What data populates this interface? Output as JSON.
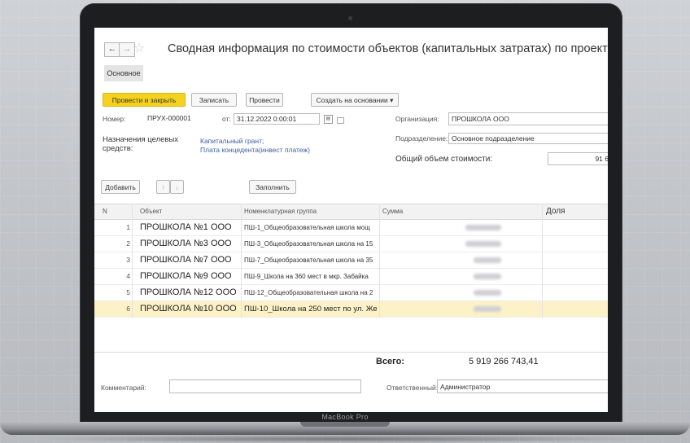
{
  "device_label": "MacBook Pro",
  "window": {
    "title": "Сводная информация по стоимости объектов (капитальных затратах) по проектам груп",
    "nav": {
      "back": "←",
      "forward": "→",
      "favorite": "☆"
    }
  },
  "tabs": {
    "main": "Основное"
  },
  "toolbar": {
    "post_close": "Провести и закрыть",
    "save": "Записать",
    "post": "Провести",
    "create_based": "Создать на основании ▾"
  },
  "form": {
    "number_label": "Номер:",
    "number_value": "ПРУХ-000001",
    "date_label": "от:",
    "date_value": "31.12.2022  0:00:01",
    "purpose_label_1": "Назначения целевых",
    "purpose_label_2": "средств:",
    "purpose_link_1": "Капитальный грант;",
    "purpose_link_2": "Плата концедента(инвест платеж)",
    "org_label": "Организация:",
    "org_value": "ПРОШКОЛА   ООО",
    "division_label": "Подразделение:",
    "division_value": "Основное подразделение",
    "total_cost_label": "Общий объем стоимости:",
    "total_cost_value": "91 6"
  },
  "table_toolbar": {
    "add": "Добавить",
    "up": "↑",
    "down": "↓",
    "fill": "Заполнить"
  },
  "table": {
    "headers": [
      "N",
      "Объект",
      "Номенклатурная группа",
      "Сумма",
      "Доля"
    ],
    "rows": [
      {
        "n": "1",
        "object": "ПРОШКОЛА №1 ООО",
        "group": "ПШ-1_Общеобразовательная школа мощ"
      },
      {
        "n": "2",
        "object": "ПРОШКОЛА №3 ООО",
        "group": "ПШ-3_Общеобразовательная школа на 15"
      },
      {
        "n": "3",
        "object": "ПРОШКОЛА №7 ООО",
        "group": "ПШ-7_Общеобразовательная школа на 35"
      },
      {
        "n": "4",
        "object": "ПРОШКОЛА №9 ООО",
        "group": "ПШ-9_Школа на 360 мест в мкр. Забайка"
      },
      {
        "n": "5",
        "object": "ПРОШКОЛА №12 ООО",
        "group": "ПШ-12_Общеобразовательная школа на 2"
      },
      {
        "n": "6",
        "object": "ПРОШКОЛА №10 ООО",
        "group": "ПШ-10_Школа на 250 мест по ул. Же"
      }
    ],
    "total_label": "Всего:",
    "total_value": "5 919 266 743,41"
  },
  "footer": {
    "comment_label": "Комментарий:",
    "responsible_label": "Ответственный:",
    "responsible_value": "Администратор"
  }
}
